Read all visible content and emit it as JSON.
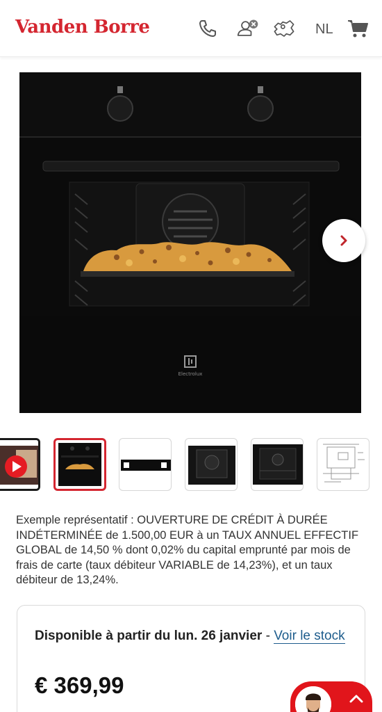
{
  "header": {
    "logo": "Vanden Borre",
    "language": "NL",
    "icons": [
      "phone-icon",
      "account-icon",
      "store-locator-icon",
      "cart-icon"
    ]
  },
  "gallery": {
    "brand_text": "Electrolux",
    "next_icon": "chevron-right-icon",
    "thumbnail_count": 6,
    "active_thumbnail": 2
  },
  "credit": {
    "text": "Exemple représentatif : OUVERTURE DE CRÉDIT À DURÉE INDÉTERMINÉE de 1.500,00 EUR à un TAUX ANNUEL EFFECTIF GLOBAL de 14,50 % dont 0,02% du capital emprunté par mois de frais de carte (taux débiteur VARIABLE de 14,23%), et un taux débiteur de 13,24%."
  },
  "availability": {
    "text": "Disponible à partir du lun. 26 janvier",
    "separator": " - ",
    "link": "Voir le stock"
  },
  "price": "€ 369,99",
  "colors": {
    "brand_red": "#d42630",
    "link_blue": "#1d5c8c",
    "chat_red": "#e1151b"
  }
}
